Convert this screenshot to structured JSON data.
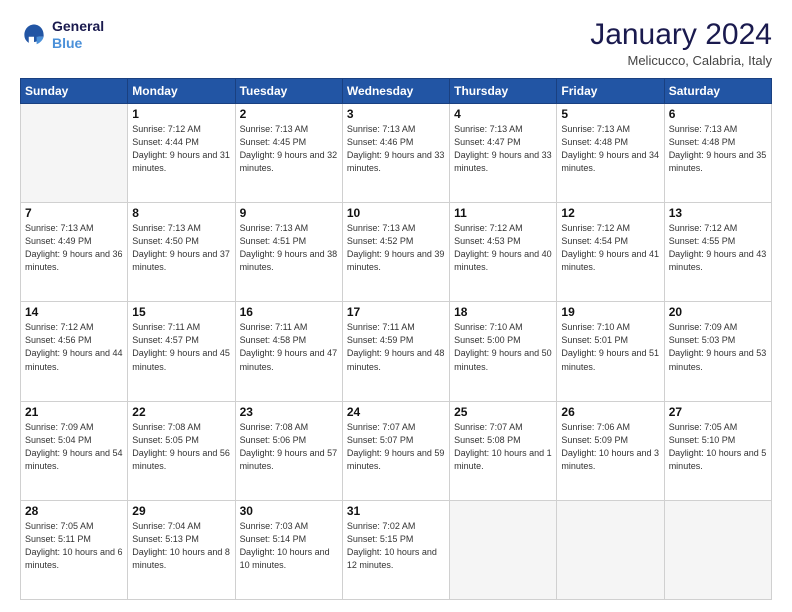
{
  "header": {
    "logo_line1": "General",
    "logo_line2": "Blue",
    "month": "January 2024",
    "location": "Melicucco, Calabria, Italy"
  },
  "weekdays": [
    "Sunday",
    "Monday",
    "Tuesday",
    "Wednesday",
    "Thursday",
    "Friday",
    "Saturday"
  ],
  "weeks": [
    [
      {
        "day": "",
        "empty": true
      },
      {
        "day": "1",
        "sunrise": "7:12 AM",
        "sunset": "4:44 PM",
        "daylight": "9 hours and 31 minutes."
      },
      {
        "day": "2",
        "sunrise": "7:13 AM",
        "sunset": "4:45 PM",
        "daylight": "9 hours and 32 minutes."
      },
      {
        "day": "3",
        "sunrise": "7:13 AM",
        "sunset": "4:46 PM",
        "daylight": "9 hours and 33 minutes."
      },
      {
        "day": "4",
        "sunrise": "7:13 AM",
        "sunset": "4:47 PM",
        "daylight": "9 hours and 33 minutes."
      },
      {
        "day": "5",
        "sunrise": "7:13 AM",
        "sunset": "4:48 PM",
        "daylight": "9 hours and 34 minutes."
      },
      {
        "day": "6",
        "sunrise": "7:13 AM",
        "sunset": "4:48 PM",
        "daylight": "9 hours and 35 minutes."
      }
    ],
    [
      {
        "day": "7",
        "sunrise": "7:13 AM",
        "sunset": "4:49 PM",
        "daylight": "9 hours and 36 minutes."
      },
      {
        "day": "8",
        "sunrise": "7:13 AM",
        "sunset": "4:50 PM",
        "daylight": "9 hours and 37 minutes."
      },
      {
        "day": "9",
        "sunrise": "7:13 AM",
        "sunset": "4:51 PM",
        "daylight": "9 hours and 38 minutes."
      },
      {
        "day": "10",
        "sunrise": "7:13 AM",
        "sunset": "4:52 PM",
        "daylight": "9 hours and 39 minutes."
      },
      {
        "day": "11",
        "sunrise": "7:12 AM",
        "sunset": "4:53 PM",
        "daylight": "9 hours and 40 minutes."
      },
      {
        "day": "12",
        "sunrise": "7:12 AM",
        "sunset": "4:54 PM",
        "daylight": "9 hours and 41 minutes."
      },
      {
        "day": "13",
        "sunrise": "7:12 AM",
        "sunset": "4:55 PM",
        "daylight": "9 hours and 43 minutes."
      }
    ],
    [
      {
        "day": "14",
        "sunrise": "7:12 AM",
        "sunset": "4:56 PM",
        "daylight": "9 hours and 44 minutes."
      },
      {
        "day": "15",
        "sunrise": "7:11 AM",
        "sunset": "4:57 PM",
        "daylight": "9 hours and 45 minutes."
      },
      {
        "day": "16",
        "sunrise": "7:11 AM",
        "sunset": "4:58 PM",
        "daylight": "9 hours and 47 minutes."
      },
      {
        "day": "17",
        "sunrise": "7:11 AM",
        "sunset": "4:59 PM",
        "daylight": "9 hours and 48 minutes."
      },
      {
        "day": "18",
        "sunrise": "7:10 AM",
        "sunset": "5:00 PM",
        "daylight": "9 hours and 50 minutes."
      },
      {
        "day": "19",
        "sunrise": "7:10 AM",
        "sunset": "5:01 PM",
        "daylight": "9 hours and 51 minutes."
      },
      {
        "day": "20",
        "sunrise": "7:09 AM",
        "sunset": "5:03 PM",
        "daylight": "9 hours and 53 minutes."
      }
    ],
    [
      {
        "day": "21",
        "sunrise": "7:09 AM",
        "sunset": "5:04 PM",
        "daylight": "9 hours and 54 minutes."
      },
      {
        "day": "22",
        "sunrise": "7:08 AM",
        "sunset": "5:05 PM",
        "daylight": "9 hours and 56 minutes."
      },
      {
        "day": "23",
        "sunrise": "7:08 AM",
        "sunset": "5:06 PM",
        "daylight": "9 hours and 57 minutes."
      },
      {
        "day": "24",
        "sunrise": "7:07 AM",
        "sunset": "5:07 PM",
        "daylight": "9 hours and 59 minutes."
      },
      {
        "day": "25",
        "sunrise": "7:07 AM",
        "sunset": "5:08 PM",
        "daylight": "10 hours and 1 minute."
      },
      {
        "day": "26",
        "sunrise": "7:06 AM",
        "sunset": "5:09 PM",
        "daylight": "10 hours and 3 minutes."
      },
      {
        "day": "27",
        "sunrise": "7:05 AM",
        "sunset": "5:10 PM",
        "daylight": "10 hours and 5 minutes."
      }
    ],
    [
      {
        "day": "28",
        "sunrise": "7:05 AM",
        "sunset": "5:11 PM",
        "daylight": "10 hours and 6 minutes."
      },
      {
        "day": "29",
        "sunrise": "7:04 AM",
        "sunset": "5:13 PM",
        "daylight": "10 hours and 8 minutes."
      },
      {
        "day": "30",
        "sunrise": "7:03 AM",
        "sunset": "5:14 PM",
        "daylight": "10 hours and 10 minutes."
      },
      {
        "day": "31",
        "sunrise": "7:02 AM",
        "sunset": "5:15 PM",
        "daylight": "10 hours and 12 minutes."
      },
      {
        "day": "",
        "empty": true
      },
      {
        "day": "",
        "empty": true
      },
      {
        "day": "",
        "empty": true
      }
    ]
  ]
}
